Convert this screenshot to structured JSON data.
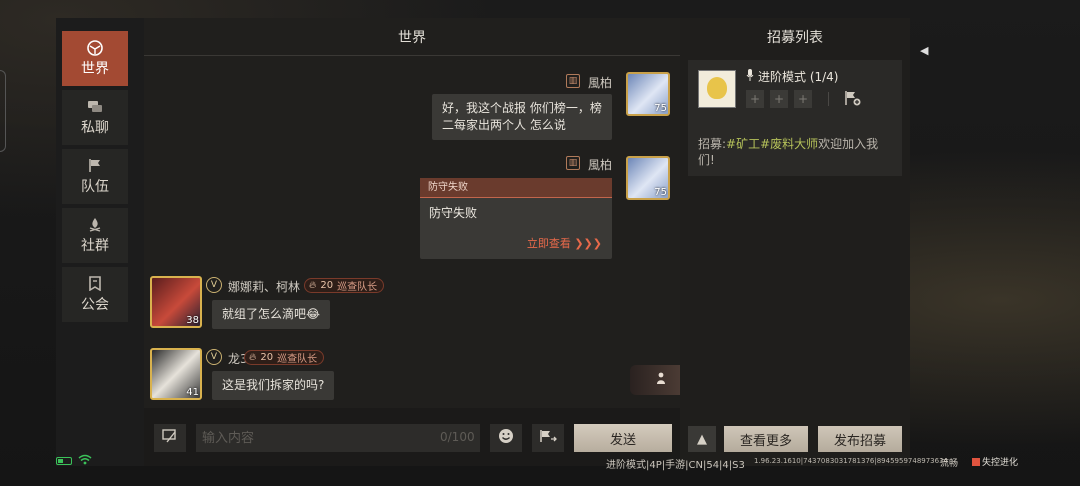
{
  "sidebar": {
    "items": [
      {
        "label": "世界",
        "icon": "globe-icon",
        "active": true
      },
      {
        "label": "私聊",
        "icon": "chat-bubbles-icon",
        "active": false
      },
      {
        "label": "队伍",
        "icon": "flag-icon",
        "active": false
      },
      {
        "label": "社群",
        "icon": "campfire-icon",
        "active": false
      },
      {
        "label": "公会",
        "icon": "guild-banner-icon",
        "active": false
      }
    ]
  },
  "chat": {
    "title": "世界",
    "messages": [
      {
        "sender": "風柏",
        "text_line1": "好，我这个战报 你们榜一，榜",
        "text_line2": "二每家出两个人 怎么说",
        "level": "75"
      },
      {
        "sender": "風柏",
        "card_title": "防守失败",
        "card_body": "防守失败",
        "card_link": "立即查看 ❯❯❯",
        "level": "75"
      },
      {
        "sender": "娜娜莉、柯林",
        "level": "38",
        "tag_value": "20",
        "tag_role": "巡查队长",
        "text": "就组了怎么滴吧😂"
      },
      {
        "sender": "龙3",
        "level": "41",
        "tag_value": "20",
        "tag_role": "巡查队长",
        "text": "这是我们拆家的吗?"
      }
    ],
    "v_badge": "V",
    "input": {
      "placeholder": "输入内容",
      "counter": "0/100"
    },
    "send_label": "发送"
  },
  "recruit": {
    "title": "招募列表",
    "mode": "进阶模式 (1/4)",
    "slots": [
      "+",
      "+",
      "+"
    ],
    "text_prefix": "招募:",
    "text_hl": "#矿工#废料大师",
    "text_suffix": "欢迎加入我们!",
    "warn_label": "▲",
    "more_label": "查看更多",
    "publish_label": "发布招募"
  },
  "status_bar": {
    "mode": "进阶模式|4P|手游|CN|54|4|S3",
    "version": "1.96.23.1610|7437083031781376|8945959748973634",
    "net": "流畅",
    "ctrl": "失控进化"
  },
  "colors": {
    "accent": "#a34a33",
    "highlight": "#b6c25a",
    "link": "#e8694a",
    "battery": "#3bc25a"
  }
}
